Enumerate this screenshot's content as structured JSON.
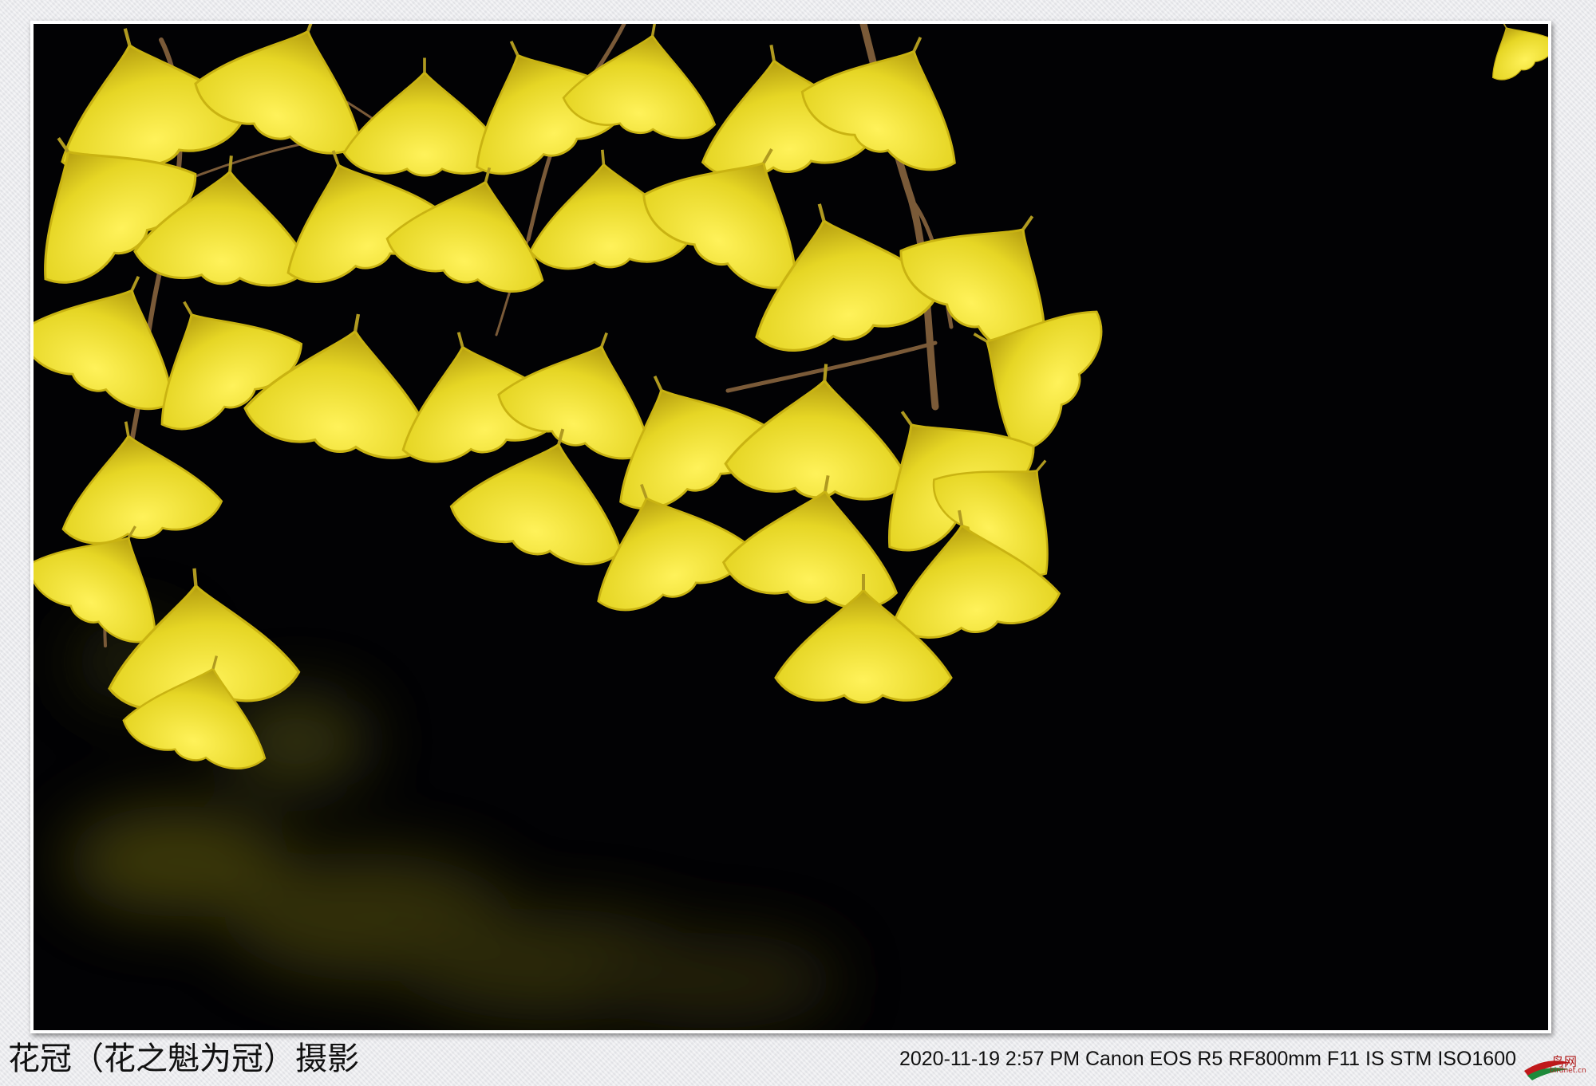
{
  "caption": {
    "author": "花冠（花之魁为冠）摄影",
    "exif": "2020-11-19  2:57 PM Canon EOS R5  RF800mm F11 IS STM ISO1600"
  },
  "logo": {
    "text": "鸟网",
    "sub": "birdnet.cn"
  },
  "colors": {
    "leaf_bright": "#f2e83a",
    "leaf_mid": "#d8c81a",
    "leaf_dark": "#a8900e",
    "background": "#020204",
    "branch": "#7a5a38",
    "logo_red": "#c0181b",
    "logo_green": "#1d8a3a"
  }
}
